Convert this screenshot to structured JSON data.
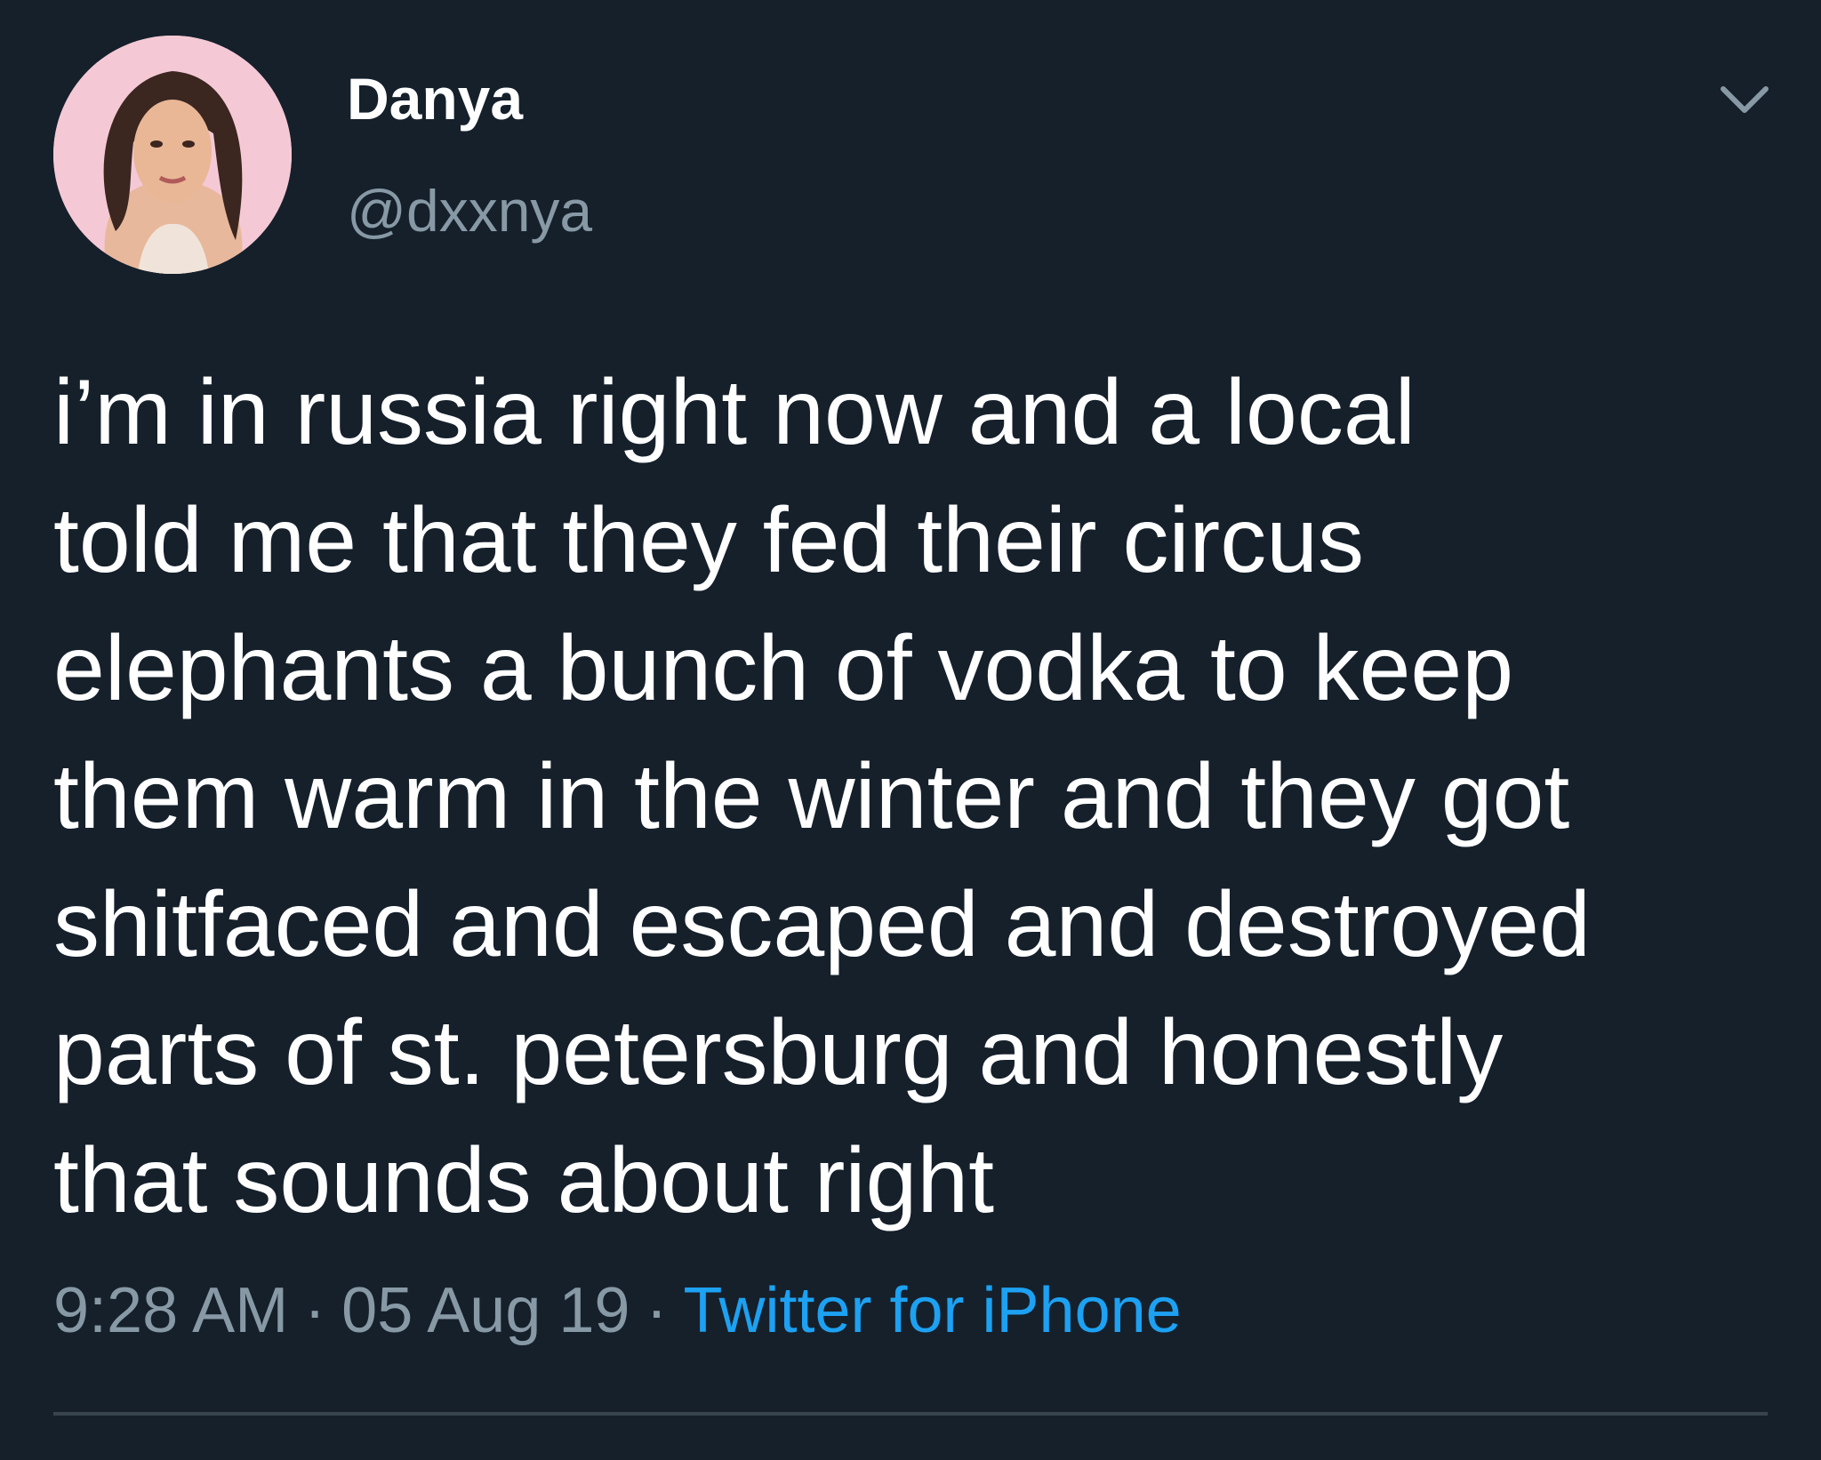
{
  "tweet": {
    "author": {
      "display_name": "Danya",
      "handle": "@dxxnya"
    },
    "text": "i’m in russia right now and a local\ntold me that they fed their circus\nelephants a bunch of vodka to keep\nthem warm in the winter and they got\nshitfaced and escaped and destroyed\nparts of st. petersburg and honestly\nthat sounds about right",
    "time": "9:28 AM",
    "date": "05 Aug 19",
    "separator": "·",
    "source": "Twitter for iPhone"
  },
  "icons": {
    "menu": "chevron-down-icon",
    "avatar": "profile-photo"
  },
  "colors": {
    "background": "#15202b",
    "primary_text": "#ffffff",
    "secondary_text": "#8899a6",
    "link": "#1da1f2",
    "divider": "#38444d"
  }
}
